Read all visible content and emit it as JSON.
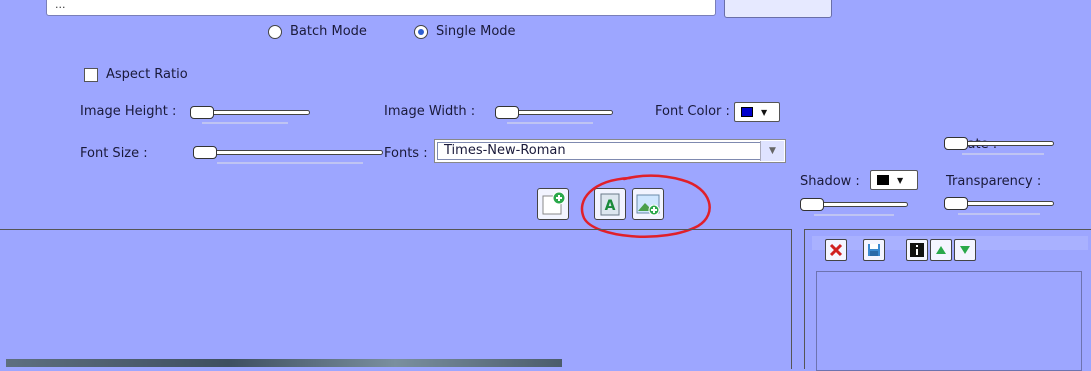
{
  "path": {
    "value": "..."
  },
  "mode": {
    "batch_label": "Batch Mode",
    "single_label": "Single Mode",
    "selected": "single"
  },
  "aspect_ratio": {
    "label": "Aspect Ratio",
    "checked": false
  },
  "image_height": {
    "label": "Image Height :"
  },
  "image_width": {
    "label": "Image Width :"
  },
  "font_color": {
    "label": "Font Color :",
    "value": "#0000cc"
  },
  "font_size": {
    "label": "Font Size :"
  },
  "fonts": {
    "label": "Fonts :",
    "value": "Times-New-Roman"
  },
  "rotate": {
    "label": "Rotate :"
  },
  "shadow": {
    "label": "Shadow :",
    "value": "#000000"
  },
  "transparency": {
    "label": "Transparency :"
  },
  "toolbar": {
    "icons": [
      "add-image-icon",
      "text-watermark-icon",
      "image-watermark-icon"
    ]
  },
  "right_panel": {
    "icons": [
      "delete-icon",
      "save-icon",
      "info-icon",
      "move-up-icon",
      "move-down-icon"
    ]
  },
  "annotation": {
    "color": "#e0202a"
  },
  "colors": {
    "background": "#9da6ff",
    "accent": "#2f5fd1"
  }
}
